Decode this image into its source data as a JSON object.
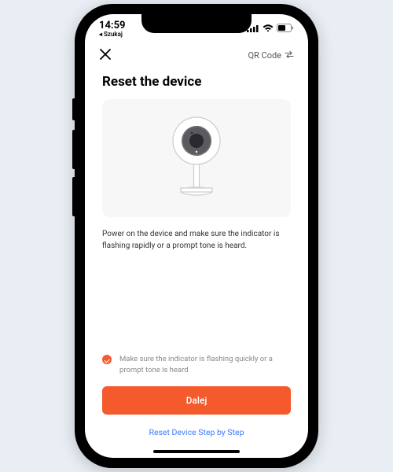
{
  "status": {
    "time": "14:59",
    "back_label": "Szukaj"
  },
  "nav": {
    "qr_label": "QR Code"
  },
  "page": {
    "title": "Reset the device",
    "instruction": "Power on the device and make sure the indicator is flashing rapidly or a prompt tone is heard.",
    "confirm_text": "Make sure the indicator is flashing quickly or a prompt tone is heard",
    "next_button": "Dalej",
    "help_link": "Reset Device Step by Step"
  },
  "colors": {
    "accent": "#f55a2c",
    "link": "#3b7bff"
  }
}
